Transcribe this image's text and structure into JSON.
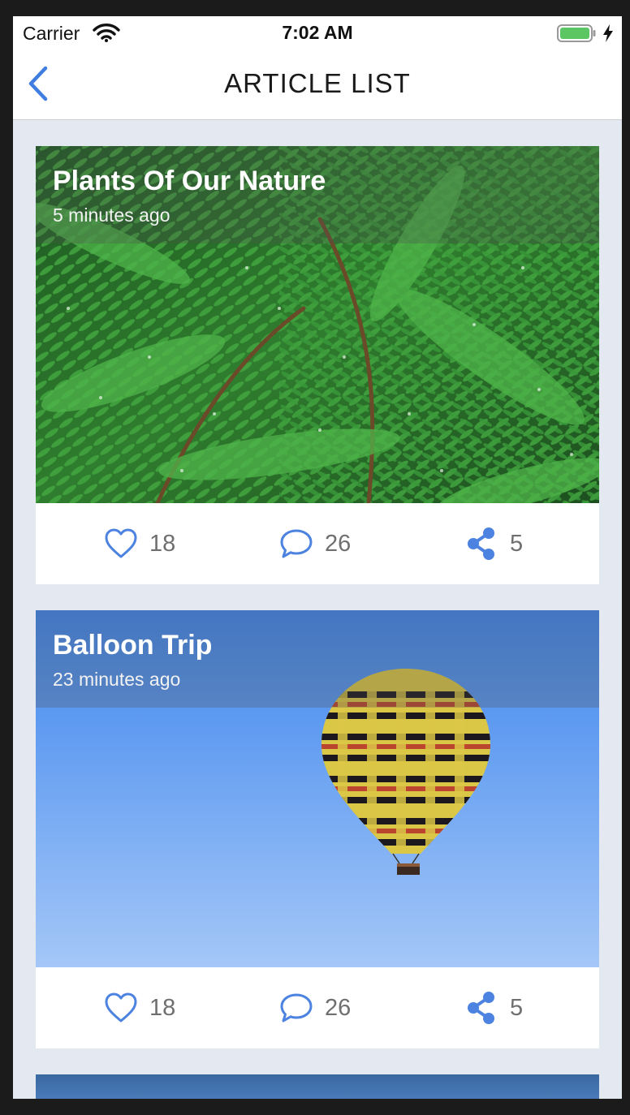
{
  "status_bar": {
    "carrier": "Carrier",
    "time": "7:02 AM",
    "battery_icon": "battery-full-icon",
    "charging_icon": "bolt-icon",
    "wifi_icon": "wifi-icon"
  },
  "nav": {
    "title": "ARTICLE LIST",
    "back_icon": "chevron-left-icon"
  },
  "colors": {
    "accent": "#3f7de0",
    "background": "#e4e8f0"
  },
  "articles": [
    {
      "title": "Plants Of Our Nature",
      "time": "5 minutes ago",
      "likes": "18",
      "comments": "26",
      "shares": "5",
      "image": "fern-leaves-photo"
    },
    {
      "title": "Balloon Trip",
      "time": "23 minutes ago",
      "likes": "18",
      "comments": "26",
      "shares": "5",
      "image": "hot-air-balloon-photo"
    },
    {
      "image": "partial-next-article-photo"
    }
  ]
}
